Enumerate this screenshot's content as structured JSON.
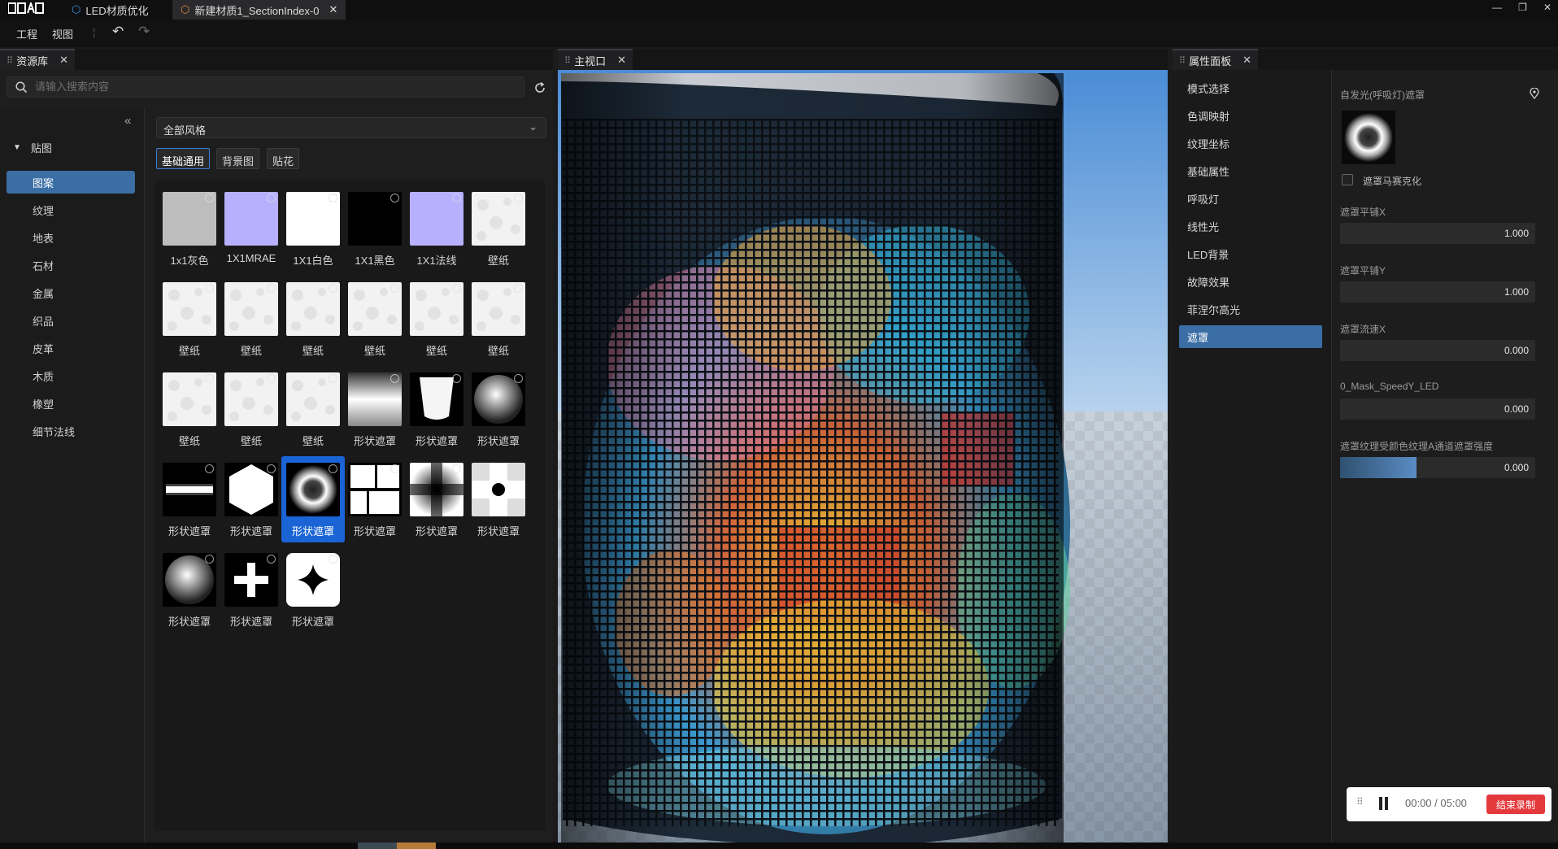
{
  "app": {
    "logo": "ꗪꗸꗯ",
    "tabs": [
      {
        "label": "LED材质优化",
        "active": false
      },
      {
        "label": "新建材质1_SectionIndex-0",
        "active": true
      }
    ],
    "window_buttons": [
      "—",
      "❐",
      "✕"
    ]
  },
  "menubar": {
    "items": [
      "工程",
      "视图"
    ],
    "undo": "↶",
    "redo": "↷"
  },
  "assets_panel": {
    "title": "资源库",
    "search_placeholder": "请输入搜索内容",
    "collapse": "«",
    "category_root": "贴图",
    "categories": [
      {
        "label": "图案",
        "selected": true
      },
      {
        "label": "纹理",
        "selected": false
      },
      {
        "label": "地表",
        "selected": false
      },
      {
        "label": "石材",
        "selected": false
      },
      {
        "label": "金属",
        "selected": false
      },
      {
        "label": "织品",
        "selected": false
      },
      {
        "label": "皮革",
        "selected": false
      },
      {
        "label": "木质",
        "selected": false
      },
      {
        "label": "橡塑",
        "selected": false
      },
      {
        "label": "细节法线",
        "selected": false
      }
    ],
    "style_select": "全部风格",
    "chips": [
      {
        "label": "基础通用",
        "selected": true
      },
      {
        "label": "背景图",
        "selected": false
      },
      {
        "label": "贴花",
        "selected": false
      }
    ],
    "items": [
      {
        "label": "1x1灰色",
        "kind": "gray"
      },
      {
        "label": "1X1MRAE",
        "kind": "lavender"
      },
      {
        "label": "1X1白色",
        "kind": "white"
      },
      {
        "label": "1X1黑色",
        "kind": "black"
      },
      {
        "label": "1X1法线",
        "kind": "lavender"
      },
      {
        "label": "壁纸",
        "kind": "paper"
      },
      {
        "label": "壁纸",
        "kind": "paper"
      },
      {
        "label": "壁纸",
        "kind": "paper"
      },
      {
        "label": "壁纸",
        "kind": "paper"
      },
      {
        "label": "壁纸",
        "kind": "paper"
      },
      {
        "label": "壁纸",
        "kind": "paper"
      },
      {
        "label": "壁纸",
        "kind": "paper"
      },
      {
        "label": "壁纸",
        "kind": "paper"
      },
      {
        "label": "壁纸",
        "kind": "paper"
      },
      {
        "label": "壁纸",
        "kind": "paper"
      },
      {
        "label": "形状遮罩",
        "kind": "gradient"
      },
      {
        "label": "形状遮罩",
        "kind": "cup"
      },
      {
        "label": "形状遮罩",
        "kind": "sphere"
      },
      {
        "label": "形状遮罩",
        "kind": "bar"
      },
      {
        "label": "形状遮罩",
        "kind": "hexagon"
      },
      {
        "label": "形状遮罩",
        "kind": "ring",
        "selected": true
      },
      {
        "label": "形状遮罩",
        "kind": "tiles"
      },
      {
        "label": "形状遮罩",
        "kind": "cross-soft"
      },
      {
        "label": "形状遮罩",
        "kind": "cross-inv"
      },
      {
        "label": "形状遮罩",
        "kind": "sphere"
      },
      {
        "label": "形状遮罩",
        "kind": "plus"
      },
      {
        "label": "形状遮罩",
        "kind": "star4"
      }
    ]
  },
  "viewport": {
    "title": "主视口"
  },
  "props_panel": {
    "title": "属性面板",
    "nav": [
      {
        "label": "模式选择",
        "selected": false
      },
      {
        "label": "色调映射",
        "selected": false
      },
      {
        "label": "纹理坐标",
        "selected": false
      },
      {
        "label": "基础属性",
        "selected": false
      },
      {
        "label": "呼吸灯",
        "selected": false
      },
      {
        "label": "线性光",
        "selected": false
      },
      {
        "label": "LED背景",
        "selected": false
      },
      {
        "label": "故障效果",
        "selected": false
      },
      {
        "label": "菲涅尔高光",
        "selected": false
      },
      {
        "label": "遮罩",
        "selected": true
      }
    ],
    "mask_title": "自发光(呼吸灯)遮罩",
    "mosaic_label": "遮罩马赛克化",
    "sliders": [
      {
        "label": "遮罩平铺X",
        "value": "1.000",
        "fill": 0.0
      },
      {
        "label": "遮罩平铺Y",
        "value": "1.000",
        "fill": 0.0
      },
      {
        "label": "遮罩流速X",
        "value": "0.000",
        "fill": 0.0
      },
      {
        "label": "0_Mask_SpeedY_LED",
        "value": "0.000",
        "fill": 0.0
      },
      {
        "label": "遮罩纹理受颜色纹理A通道遮罩强度",
        "value": "0.000",
        "fill": 0.39
      }
    ]
  },
  "recorder": {
    "time": "00:00 / 05:00",
    "stop_label": "结束录制"
  }
}
